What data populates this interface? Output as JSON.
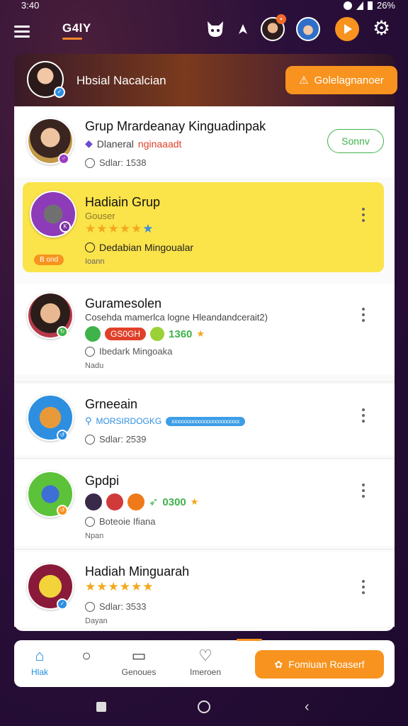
{
  "status": {
    "time": "3:40",
    "battery": "26%"
  },
  "app": {
    "title": "G4lY"
  },
  "header": {
    "name": "Hbsial Nacalcian",
    "action_label": "Golelagnanoer"
  },
  "items": [
    {
      "title": "Grup Mrardeanay Kinguadinpak",
      "sub_prefix": "Dlaneral",
      "sub_accent": "nginaaadt",
      "meta": "Sdlar: 1538",
      "button": "Sonnv"
    },
    {
      "title": "Hadiain Grup",
      "sub": "Gouser",
      "meta": "Dedabian Mingoualar",
      "tiny": "Ioann",
      "badge": "B ond",
      "rating": 5
    },
    {
      "title": "Guramesolen",
      "sub": "Cosehda mamerlca logne Hleandandcerait2)",
      "pill": "GS0GH",
      "count": "1360",
      "meta": "Ibedark Mingoaka",
      "tiny": "Nadu"
    },
    {
      "title": "Grneeain",
      "tag1": "MORSIRDOGKG",
      "tag2": "xxxxxxxxxxxxxxxxxxxxxxxx",
      "meta": "Sdlar: 2539"
    },
    {
      "title": "Gpdpi",
      "count": "0300",
      "meta": "Boteoie Ifiana",
      "tiny": "Npan"
    },
    {
      "title": "Hadiah Minguarah",
      "rating": 5,
      "meta": "Sdlar: 3533",
      "tiny": "Dayan"
    }
  ],
  "bottom_nav": {
    "items": [
      {
        "label": "Hlak"
      },
      {
        "label": ""
      },
      {
        "label": "Genoues"
      },
      {
        "label": "Imeroen"
      }
    ],
    "cta_label": "Fomiuan Roaserf"
  },
  "colors": {
    "accent": "#f7931e",
    "highlight": "#fbe34a",
    "active": "#1e90e0",
    "follow": "#3fb24a"
  }
}
